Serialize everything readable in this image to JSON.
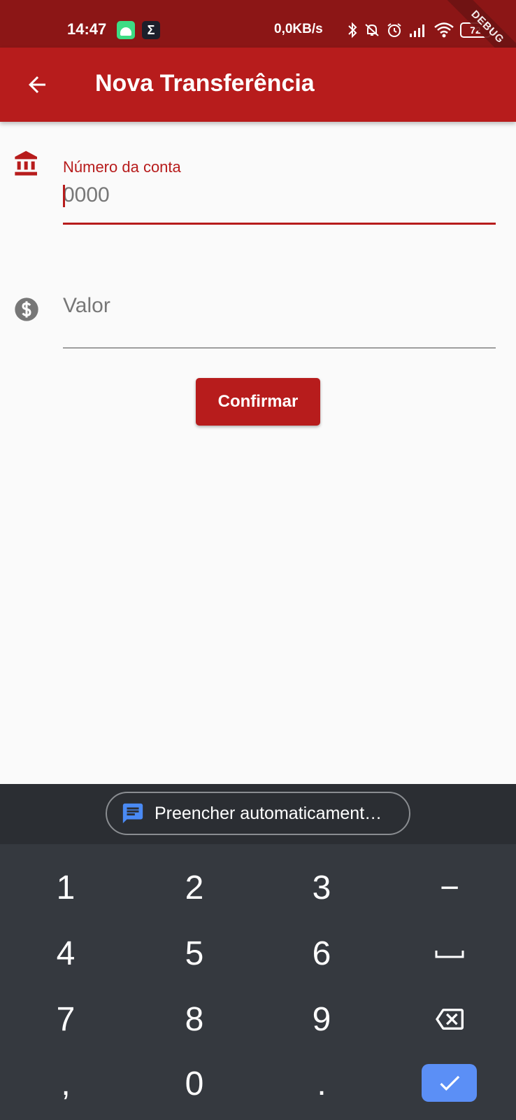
{
  "status_bar": {
    "time": "14:47",
    "sigma_label": "Σ",
    "network_speed": "0,0KB/s",
    "battery_level": "72",
    "icons": [
      "android-icon",
      "sigma-icon",
      "bluetooth-icon",
      "notifications-off-icon",
      "alarm-icon",
      "signal-icon",
      "wifi-icon",
      "battery-icon"
    ]
  },
  "debug_banner": "DEBUG",
  "app_bar": {
    "title": "Nova Transferência",
    "back_icon": "arrow-back-icon"
  },
  "form": {
    "account_field": {
      "label": "Número da conta",
      "placeholder": "0000",
      "icon": "bank-icon"
    },
    "value_field": {
      "placeholder": "Valor",
      "icon": "dollar-icon"
    },
    "confirm_label": "Confirmar"
  },
  "autofill": {
    "label": "Preencher automaticament…",
    "icon": "message-icon"
  },
  "keyboard": {
    "rows": [
      [
        "1",
        "2",
        "3",
        "−"
      ],
      [
        "4",
        "5",
        "6",
        "space"
      ],
      [
        "7",
        "8",
        "9",
        "backspace"
      ],
      [
        ",",
        "0",
        ".",
        "enter"
      ]
    ],
    "keys": {
      "k1": "1",
      "k2": "2",
      "k3": "3",
      "minus": "−",
      "k4": "4",
      "k5": "5",
      "k6": "6",
      "k7": "7",
      "k8": "8",
      "k9": "9",
      "comma": ",",
      "k0": "0",
      "period": "."
    }
  },
  "colors": {
    "primary": "#b71c1c",
    "primary_dark": "#8c1616",
    "enter_key": "#5b8ff6",
    "keyboard_bg": "#35393f"
  }
}
